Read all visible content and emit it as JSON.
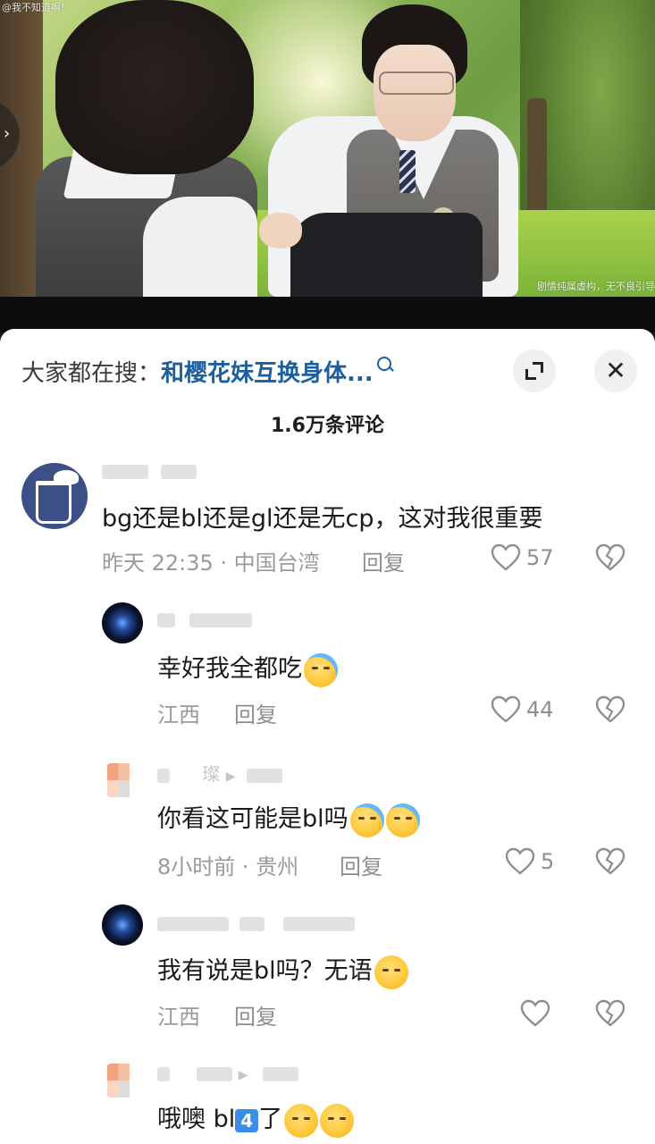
{
  "video": {
    "watermark_top": "@我不知道啊!",
    "watermark_bottom": "剧情纯属虚构，无不良引导",
    "side_arrow": "chevron-right-icon"
  },
  "sheet": {
    "search_prefix": "大家都在搜：",
    "search_link": "和樱花妹互换身体...",
    "search_icon": "search-icon",
    "expand_icon": "expand-icon",
    "close_icon": "close-icon",
    "close_glyph": "✕",
    "comment_count": "1.6万条评论"
  },
  "comments": [
    {
      "text": "bg还是bl还是gl还是无cp，这对我很重要",
      "meta": "昨天 22:35 · 中国台湾",
      "reply_label": "回复",
      "likes": "57"
    },
    {
      "text": "幸好我全都吃",
      "meta": "江西",
      "reply_label": "回复",
      "likes": "44"
    },
    {
      "username_fragment": "璨",
      "text": "你看这可能是bl吗",
      "meta": "8小时前 · 贵州",
      "reply_label": "回复",
      "likes": "5"
    },
    {
      "text": "我有说是bl吗？无语",
      "meta": "江西",
      "reply_label": "回复",
      "likes": ""
    },
    {
      "text_before": "哦噢  bl",
      "key_digit": "4",
      "text_after": "了"
    }
  ],
  "colors": {
    "link": "#1c5f9e",
    "text": "#1a1a1a",
    "muted": "#9a9a9a"
  }
}
